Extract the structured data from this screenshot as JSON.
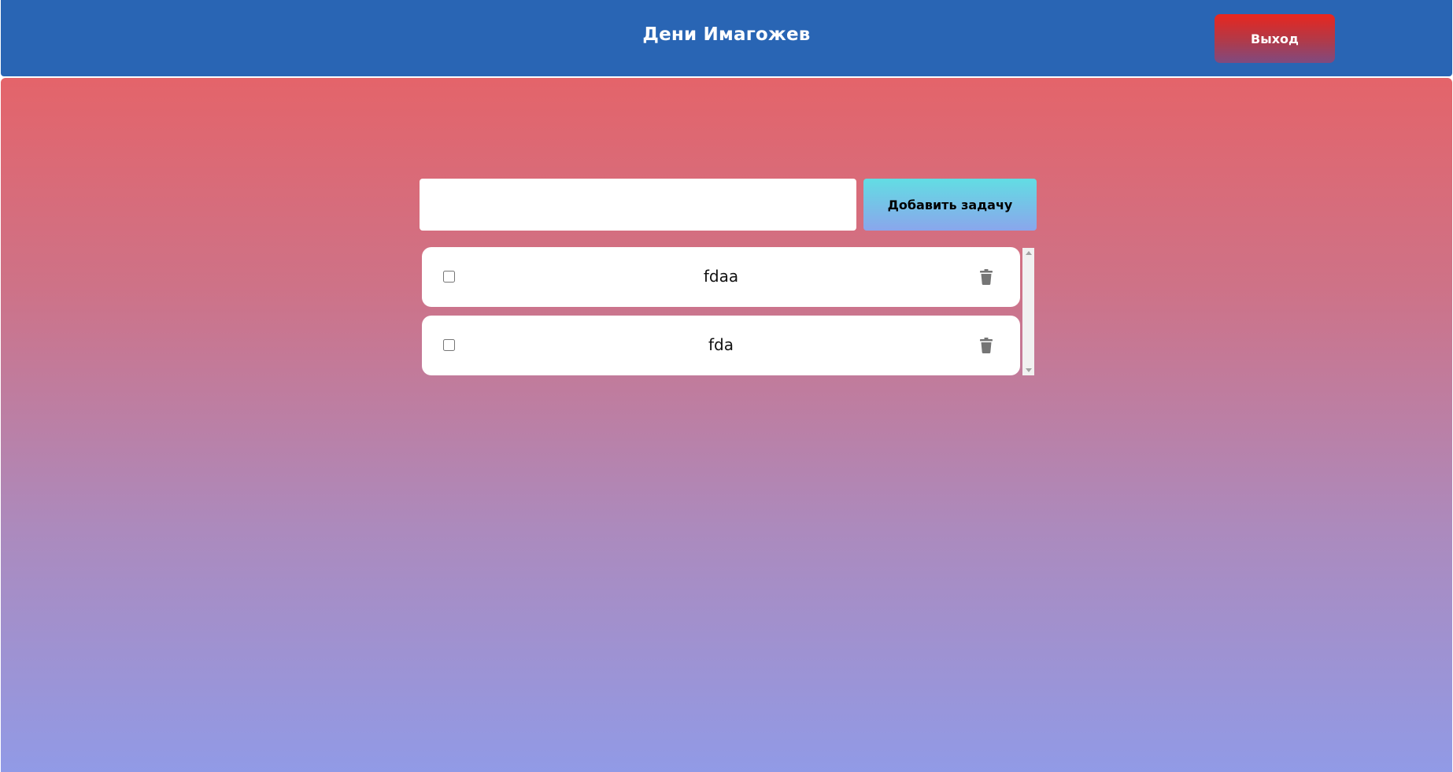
{
  "header": {
    "title": "Дени Имагожев",
    "logout_label": "Выход"
  },
  "composer": {
    "input_value": "",
    "input_placeholder": "",
    "add_label": "Добавить задачу"
  },
  "tasks": [
    {
      "text": "fdaa",
      "done": false
    },
    {
      "text": "fda",
      "done": false
    }
  ],
  "colors": {
    "header_bg": "#2965b4",
    "logout_gradient": [
      "#e8261e",
      "#7f4a80"
    ],
    "background_gradient": [
      "#e4646a",
      "#919ae6"
    ],
    "add_gradient": [
      "#62dde3",
      "#8aa6ec"
    ],
    "trash_icon": "#757575"
  },
  "icons": {
    "delete": "trash-icon"
  }
}
